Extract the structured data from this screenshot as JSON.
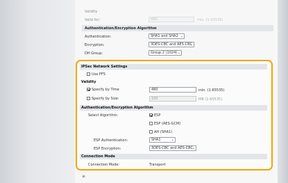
{
  "top": {
    "validity": "Validity",
    "valid_for_label": "Valid for:",
    "valid_for_value": "480",
    "valid_for_unit": "min. (1-65535)",
    "auth_enc_header": "Authentication/Encryption Algorithm",
    "authentication_label": "Authentication:",
    "authentication_value": "SHA1 and SHA2",
    "encryption_label": "Encryption:",
    "encryption_value": "3DES-CBC and AES-CBC",
    "dh_group_label": "DH Group:",
    "dh_group_value": "Group 2 (1024)"
  },
  "ipsec": {
    "header": "IPSec Network Settings",
    "use_pfs": "Use PFS",
    "validity_header": "Validity",
    "specify_time_label": "Specify by Time",
    "specify_time_value": "480",
    "specify_time_unit": "min. (1-65535)",
    "specify_size_label": "Specify by Size:",
    "specify_size_value": "100",
    "specify_size_unit": "MB (1-65535)",
    "auth_enc_header": "Authentication/Encryption Algorithm",
    "select_algorithm_label": "Select Algorithm:",
    "alg_esp": "ESP",
    "alg_esp_gcm": "ESP (AES-GCM)",
    "alg_ah": "AH (SHA1)",
    "esp_auth_label": "ESP Authentication:",
    "esp_auth_value": "SHA1",
    "esp_enc_label": "ESP Encryption:",
    "esp_enc_value": "3DES-CBC and AES-CBC",
    "conn_mode_header": "Connection Mode",
    "conn_mode_label": "Connection Mode:",
    "conn_mode_value": "Transport"
  },
  "checks": {
    "use_pfs": false,
    "specify_time": true,
    "specify_size": false,
    "alg_esp": true,
    "alg_esp_gcm": false,
    "alg_ah": false
  },
  "icons": {
    "chevron": "chevron-down-icon",
    "checkbox": "checkbox-icon"
  },
  "colors": {
    "highlight_border": "#f2a500",
    "section_bg": "#e3e5e8"
  },
  "bottom_glyph": "≥"
}
